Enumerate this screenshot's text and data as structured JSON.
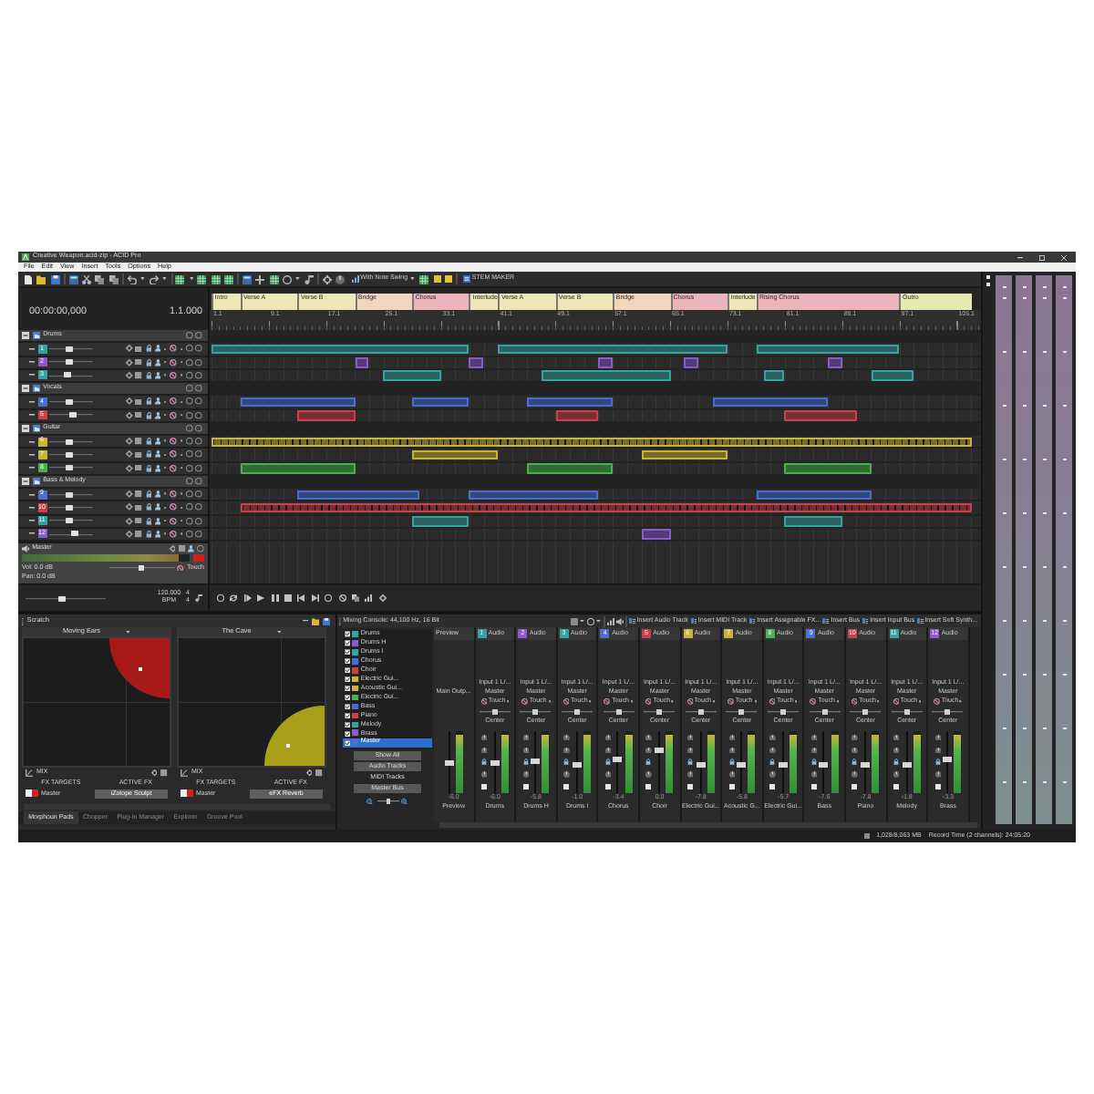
{
  "window": {
    "title": "Creative Weapon.acid-zip - ACID Pro"
  },
  "menu": [
    "File",
    "Edit",
    "View",
    "Insert",
    "Tools",
    "Options",
    "Help"
  ],
  "toolbar": {
    "swing": "With Note Swing",
    "stem_maker": "STEM MAKER"
  },
  "time": {
    "position": "00:00:00,000",
    "beat": "1.1.000"
  },
  "markers": [
    {
      "label": "Intro",
      "color": "#ede6b6"
    },
    {
      "label": "Verse A",
      "color": "#ede6b6"
    },
    {
      "label": "Verse B",
      "color": "#ede6b6"
    },
    {
      "label": "Bridge",
      "color": "#f0d6bc"
    },
    {
      "label": "Chorus",
      "color": "#e9b4ba"
    },
    {
      "label": "Interlude",
      "color": "#ede6b6"
    },
    {
      "label": "Verse A",
      "color": "#ede6b6"
    },
    {
      "label": "Verse B",
      "color": "#ede6b6"
    },
    {
      "label": "Bridge",
      "color": "#f0d6bc"
    },
    {
      "label": "Chorus",
      "color": "#e9b4ba"
    },
    {
      "label": "Interlude",
      "color": "#ede6b6"
    },
    {
      "label": "Rising Chorus",
      "color": "#e9b4ba"
    },
    {
      "label": "Outro",
      "color": "#e6eab2"
    }
  ],
  "ruler": [
    "1.1",
    "9.1",
    "17.1",
    "25.1",
    "33.1",
    "41.1",
    "49.1",
    "57.1",
    "65.1",
    "73.1",
    "81.1",
    "89.1",
    "97.1",
    "105.1"
  ],
  "tracks": [
    {
      "kind": "folder",
      "name": "Drums",
      "expanded": true,
      "children": [
        {
          "kind": "track",
          "number": "1",
          "color": "#38a39c",
          "level": 0.45
        },
        {
          "kind": "track",
          "number": "2",
          "color": "#8b5cc8",
          "level": 0.45
        },
        {
          "kind": "track",
          "number": "3",
          "color": "#38a39c",
          "level": 0.4
        }
      ]
    },
    {
      "kind": "folder",
      "name": "Vocals",
      "expanded": true,
      "children": [
        {
          "kind": "track",
          "number": "4",
          "color": "#4a6fd0",
          "level": 0.45
        },
        {
          "kind": "track",
          "number": "5",
          "color": "#c8424c",
          "level": 0.55
        }
      ]
    },
    {
      "kind": "folder",
      "name": "Guitar",
      "expanded": true,
      "children": [
        {
          "kind": "track",
          "number": "6",
          "color": "#c8b43c",
          "level": 0.45
        },
        {
          "kind": "track",
          "number": "7",
          "color": "#c8b43c",
          "level": 0.45
        },
        {
          "kind": "track",
          "number": "8",
          "color": "#4caf50",
          "level": 0.45
        }
      ]
    },
    {
      "kind": "folder",
      "name": "Bass & Melody",
      "expanded": true,
      "children": [
        {
          "kind": "track",
          "number": "9",
          "color": "#4a6fd0",
          "level": 0.45
        },
        {
          "kind": "track",
          "number": "10",
          "color": "#c8424c",
          "level": 0.45
        },
        {
          "kind": "track",
          "number": "11",
          "color": "#38a39c",
          "level": 0.45
        },
        {
          "kind": "track",
          "number": "12",
          "color": "#8b5cc8",
          "level": 0.6
        }
      ]
    }
  ],
  "master": {
    "name": "Master",
    "volume": "Vol: 0.0 dB",
    "pan": "Pan: 0.0 dB",
    "automation": "Touch",
    "meter": {
      "level": 0.93
    },
    "fader": {
      "level": 0.5
    }
  },
  "tempo": {
    "bpm": "120.000",
    "unit": "BPM",
    "beats": "4",
    "note": "4",
    "level": 0.45
  },
  "scratch": {
    "title": "Scratch",
    "pads": [
      {
        "name": "Moving Ears",
        "color": "#a81a1a",
        "kind": "top",
        "mix": "MIX",
        "targets_label": "FX TARGETS",
        "active_label": "ACTIVE FX",
        "target": "Master",
        "fx": "iZotope Sculpt"
      },
      {
        "name": "The Cave",
        "color": "#a8a018",
        "kind": "bottom",
        "mix": "MIX",
        "targets_label": "FX TARGETS",
        "active_label": "ACTIVE FX",
        "target": "Master",
        "fx": "eFX Reverb"
      }
    ],
    "tabs": [
      {
        "label": "Morphoun Pads",
        "selected": true
      },
      {
        "label": "Chopper",
        "selected": false
      },
      {
        "label": "Plug-In Manager",
        "selected": false
      },
      {
        "label": "Explorer",
        "selected": false
      },
      {
        "label": "Groove Pool",
        "selected": false
      }
    ]
  },
  "mixer": {
    "title": "Mixing Console: 44,100 Hz, 16 Bit",
    "actions": [
      {
        "label": "Insert Audio Track"
      },
      {
        "label": "Insert MIDI Track"
      },
      {
        "label": "Insert Assignable FX..."
      },
      {
        "label": "Insert Bus"
      },
      {
        "label": "Insert Input Bus"
      },
      {
        "label": "Insert Soft Synth..."
      }
    ],
    "tree": [
      {
        "name": "Drums",
        "color": "#38a39c",
        "checked": true,
        "selected": false
      },
      {
        "name": "Drums H",
        "color": "#8b5cc8",
        "checked": true,
        "selected": false
      },
      {
        "name": "Drums I",
        "color": "#38a39c",
        "checked": true,
        "selected": false
      },
      {
        "name": "Chorus",
        "color": "#4a6fd0",
        "checked": true,
        "selected": false
      },
      {
        "name": "Choir",
        "color": "#c8424c",
        "checked": true,
        "selected": false
      },
      {
        "name": "Electric Gui...",
        "color": "#c8b43c",
        "checked": true,
        "selected": false
      },
      {
        "name": "Acoustic Gui...",
        "color": "#c8b43c",
        "checked": true,
        "selected": false
      },
      {
        "name": "Electric Gui...",
        "color": "#4caf50",
        "checked": true,
        "selected": false
      },
      {
        "name": "Bass",
        "color": "#4a6fd0",
        "checked": true,
        "selected": false
      },
      {
        "name": "Piano",
        "color": "#c8424c",
        "checked": true,
        "selected": false
      },
      {
        "name": "Melody",
        "color": "#38a39c",
        "checked": true,
        "selected": false
      },
      {
        "name": "Brass",
        "color": "#8b5cc8",
        "checked": true,
        "selected": false
      },
      {
        "name": "Master",
        "color": "#4a6fd0",
        "checked": true,
        "selected": true
      }
    ],
    "filters": [
      {
        "label": "Show All",
        "on": true
      },
      {
        "label": "Audio Tracks",
        "on": true
      },
      {
        "label": "MIDI Tracks",
        "on": false
      },
      {
        "label": "Master Bus",
        "on": true
      }
    ],
    "zoom": {
      "level": 0.5
    },
    "preview": {
      "header": "Preview",
      "output": "Main Outp...",
      "value": "-6.0",
      "name": "Preview",
      "fader": {
        "level": 0.5
      },
      "meter": {
        "level": 0.95
      }
    },
    "channels": [
      {
        "number": "1",
        "type": "Audio",
        "color": "#38a39c",
        "input": "Input 1 L/...",
        "output": "Master",
        "automation": "Touch",
        "pan": {
          "label": "Center",
          "level": 0.5
        },
        "fader": {
          "level": 0.5
        },
        "meter": {
          "level": 0.95
        },
        "value": "-6.0",
        "name": "Drums"
      },
      {
        "number": "2",
        "type": "Audio",
        "color": "#8b5cc8",
        "input": "Input 1 L/...",
        "output": "Master",
        "automation": "Touch",
        "pan": {
          "label": "Center",
          "level": 0.5
        },
        "fader": {
          "level": 0.52
        },
        "meter": {
          "level": 0.95
        },
        "value": "-5.8",
        "name": "Drums H"
      },
      {
        "number": "3",
        "type": "Audio",
        "color": "#38a39c",
        "input": "Input 1 L/...",
        "output": "Master",
        "automation": "Touch",
        "pan": {
          "label": "Center",
          "level": 0.5
        },
        "fader": {
          "level": 0.44
        },
        "meter": {
          "level": 0.95
        },
        "value": "-1.0",
        "name": "Drums I"
      },
      {
        "number": "4",
        "type": "Audio",
        "color": "#4a6fd0",
        "input": "Input 1 L/...",
        "output": "Master",
        "automation": "Touch",
        "pan": {
          "label": "Center",
          "level": 0.5
        },
        "fader": {
          "level": 0.55
        },
        "meter": {
          "level": 0.95
        },
        "value": "-3.4",
        "name": "Chorus"
      },
      {
        "number": "5",
        "type": "Audio",
        "color": "#c8424c",
        "input": "Input 1 L/...",
        "output": "Master",
        "automation": "Touch",
        "pan": {
          "label": "Center",
          "level": 0.5
        },
        "fader": {
          "level": 0.72
        },
        "meter": {
          "level": 0.95
        },
        "value": "0.0",
        "name": "Choir"
      },
      {
        "number": "6",
        "type": "Audio",
        "color": "#c8b43c",
        "input": "Input 1 L/...",
        "output": "Master",
        "automation": "Touch",
        "pan": {
          "label": "Center",
          "level": 0.5
        },
        "fader": {
          "level": 0.44
        },
        "meter": {
          "level": 0.95
        },
        "value": "-7.8",
        "name": "Electric Gui..."
      },
      {
        "number": "7",
        "type": "Audio",
        "color": "#c8b43c",
        "input": "Input 1 L/...",
        "output": "Master",
        "automation": "Touch",
        "pan": {
          "label": "Center",
          "level": 0.5
        },
        "fader": {
          "level": 0.44
        },
        "meter": {
          "level": 0.95
        },
        "value": "-5.8",
        "name": "Acoustic G..."
      },
      {
        "number": "8",
        "type": "Audio",
        "color": "#4caf50",
        "input": "Input 1 L/...",
        "output": "Master",
        "automation": "Touch",
        "pan": {
          "label": "Center",
          "level": 0.5
        },
        "fader": {
          "level": 0.44
        },
        "meter": {
          "level": 0.95
        },
        "value": "-5.7",
        "name": "Electric Gui..."
      },
      {
        "number": "9",
        "type": "Audio",
        "color": "#4a6fd0",
        "input": "Input 1 L/...",
        "output": "Master",
        "automation": "Touch",
        "pan": {
          "label": "Center",
          "level": 0.5
        },
        "fader": {
          "level": 0.44
        },
        "meter": {
          "level": 0.95
        },
        "value": "-7.6",
        "name": "Bass"
      },
      {
        "number": "10",
        "type": "Audio",
        "color": "#c8424c",
        "input": "Input 1 L/...",
        "output": "Master",
        "automation": "Touch",
        "pan": {
          "label": "Center",
          "level": 0.5
        },
        "fader": {
          "level": 0.44
        },
        "meter": {
          "level": 0.95
        },
        "value": "-7.8",
        "name": "Piano"
      },
      {
        "number": "11",
        "type": "Audio",
        "color": "#38a39c",
        "input": "Input 1 L/...",
        "output": "Master",
        "automation": "Touch",
        "pan": {
          "label": "Center",
          "level": 0.5
        },
        "fader": {
          "level": 0.44
        },
        "meter": {
          "level": 0.95
        },
        "value": "-1.8",
        "name": "Melody"
      },
      {
        "number": "12",
        "type": "Audio",
        "color": "#8b5cc8",
        "input": "Input 1 L/...",
        "output": "Master",
        "automation": "Touch",
        "pan": {
          "label": "Center",
          "level": 0.5
        },
        "fader": {
          "level": 0.55
        },
        "meter": {
          "level": 0.95
        },
        "value": "-3.3",
        "name": "Brass"
      }
    ]
  },
  "status": {
    "memory": "1,028/8,063 MB",
    "record_time": "Record Time (2 channels): 24:05:20"
  }
}
